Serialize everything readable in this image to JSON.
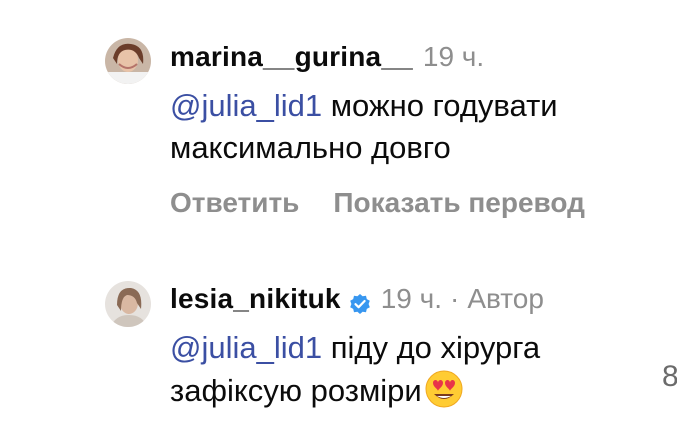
{
  "comments": [
    {
      "username": "marina__gurina__",
      "time": "19 ч.",
      "mention": "@julia_lid1",
      "text_line1": " можно годувати",
      "text_line2": "максимально довго",
      "reply_label": "Ответить",
      "translate_label": "Показать перевод"
    },
    {
      "username": "lesia_nikituk",
      "verified": true,
      "time": "19 ч.",
      "separator": "·",
      "author_label": "Автор",
      "mention": "@julia_lid1",
      "text_line1": " піду до хірурга",
      "text_line2": "зафіксую розміри",
      "emoji": "heart-eyes-emoji-icon"
    }
  ],
  "edge_text": "8",
  "colors": {
    "mention": "#3b4fa3",
    "meta": "#8e8e8e",
    "verified": "#3897f0"
  }
}
